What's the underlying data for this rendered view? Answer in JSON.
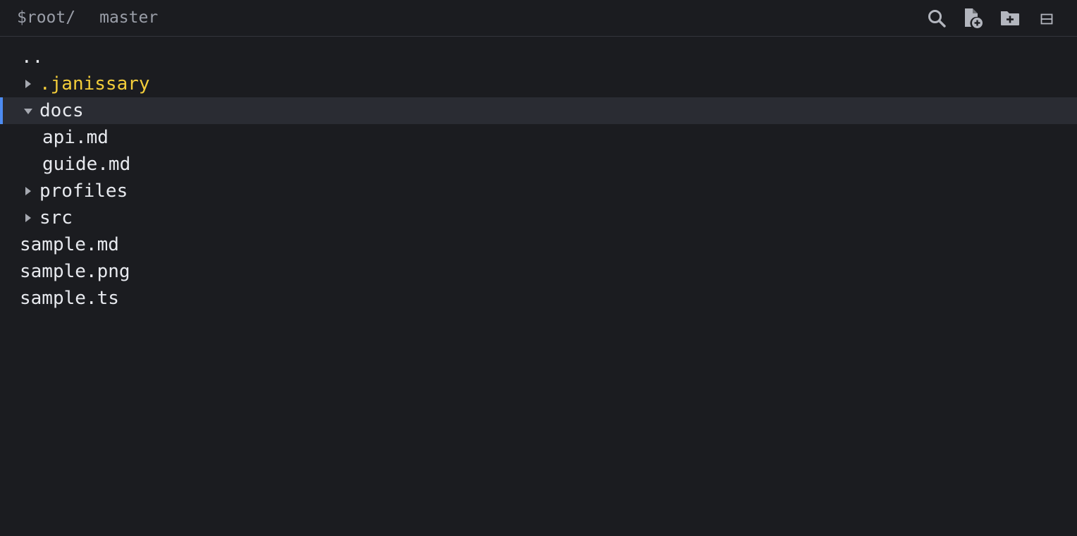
{
  "header": {
    "root": "$root/",
    "branch": "master",
    "actions": [
      {
        "name": "search",
        "icon": "search-icon"
      },
      {
        "name": "new-file",
        "icon": "file-plus-icon"
      },
      {
        "name": "new-folder",
        "icon": "folder-plus-icon"
      },
      {
        "name": "collapse-all",
        "icon": "collapse-all-icon"
      }
    ]
  },
  "tree": {
    "parent": "..",
    "items": [
      {
        "label": ".janissary",
        "type": "folder",
        "expanded": false,
        "hidden": true
      },
      {
        "label": "docs",
        "type": "folder",
        "expanded": true,
        "selected": true
      },
      {
        "label": "api.md",
        "type": "file",
        "parent": "docs"
      },
      {
        "label": "guide.md",
        "type": "file",
        "parent": "docs"
      },
      {
        "label": "profiles",
        "type": "folder",
        "expanded": false
      },
      {
        "label": "src",
        "type": "folder",
        "expanded": false
      },
      {
        "label": "sample.md",
        "type": "file"
      },
      {
        "label": "sample.png",
        "type": "file"
      },
      {
        "label": "sample.ts",
        "type": "file"
      }
    ]
  },
  "colors": {
    "background": "#1b1c20",
    "selection": "#2a2c33",
    "accent": "#4d8cf2",
    "hidden_folder": "#f3cd3a",
    "text": "#e7e9ee",
    "muted": "#9a9ea8"
  }
}
